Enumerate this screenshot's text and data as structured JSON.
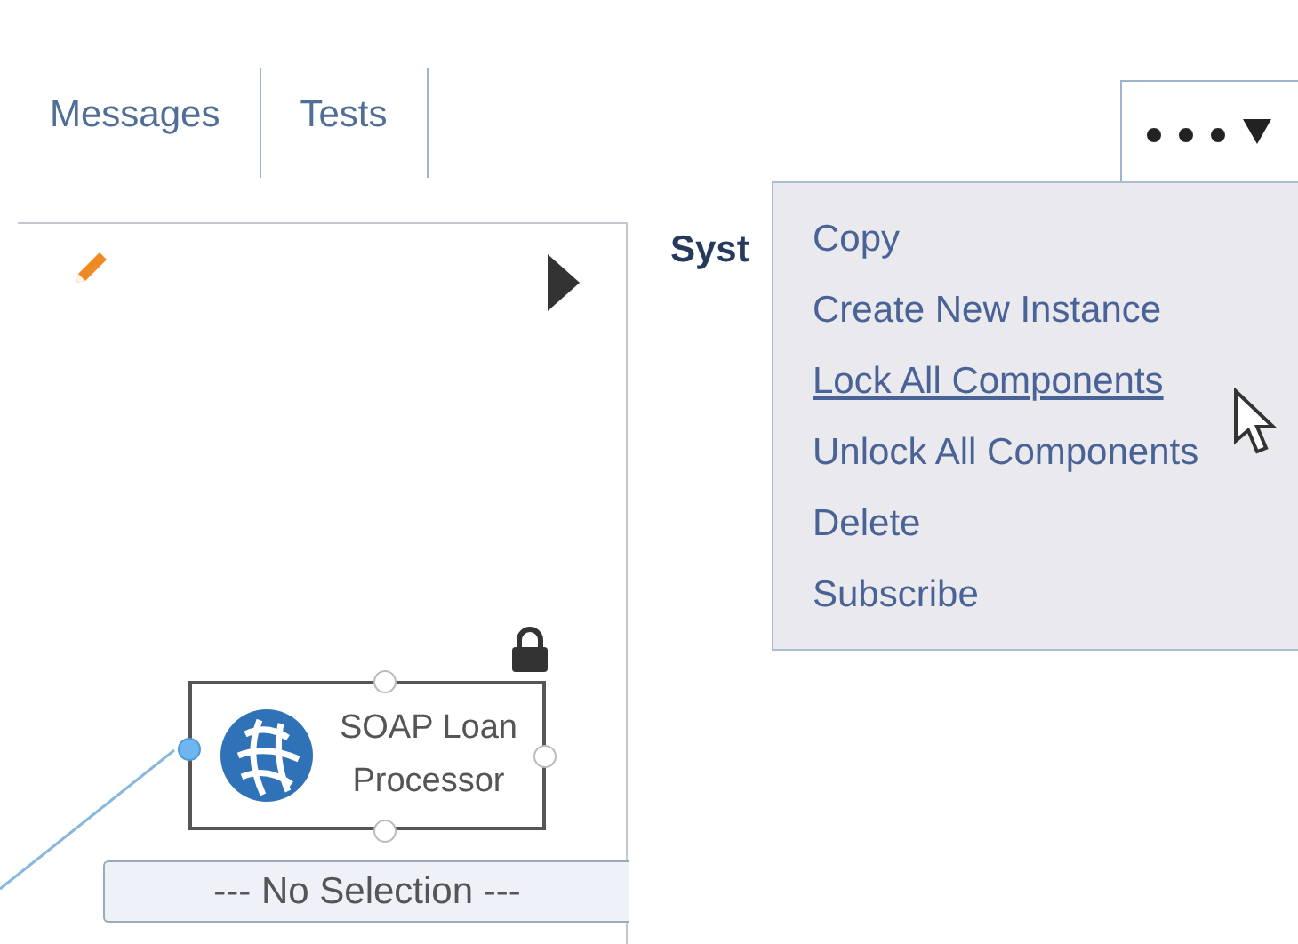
{
  "tabs": [
    {
      "label": "Messages"
    },
    {
      "label": "Tests"
    }
  ],
  "canvas": {
    "node": {
      "label": "SOAP Loan Processor",
      "locked": true
    },
    "selection_dropdown": {
      "value": "--- No Selection ---"
    }
  },
  "side_panel": {
    "heading": "Syst"
  },
  "menu": {
    "items": [
      {
        "label": "Copy",
        "hovered": false
      },
      {
        "label": "Create New Instance",
        "hovered": false
      },
      {
        "label": "Lock All Components",
        "hovered": true
      },
      {
        "label": "Unlock All Components",
        "hovered": false
      },
      {
        "label": "Delete",
        "hovered": false
      },
      {
        "label": "Subscribe",
        "hovered": false
      }
    ]
  }
}
